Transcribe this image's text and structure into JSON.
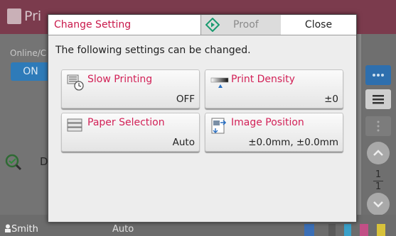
{
  "background": {
    "title_text": "Pri",
    "online_label": "Online/C",
    "on_button": "ON",
    "d_text": "D",
    "page_top": "1",
    "page_bottom": "1",
    "user": "Smith",
    "auto_text": "Auto"
  },
  "dialog": {
    "title": "Change Setting",
    "proof_label": "Proof",
    "close_label": "Close",
    "description": "The following settings can be changed.",
    "settings": [
      {
        "label": "Slow Printing",
        "value": "OFF",
        "icon": "slow-printing-icon"
      },
      {
        "label": "Print Density",
        "value": "±0",
        "icon": "print-density-icon"
      },
      {
        "label": "Paper Selection",
        "value": "Auto",
        "icon": "paper-tray-icon"
      },
      {
        "label": "Image Position",
        "value": "±0.0mm, ±0.0mm",
        "icon": "image-position-icon"
      }
    ]
  },
  "colors": {
    "accent": "#c9184a",
    "header_bg": "#7b3b4d",
    "on_button": "#2e7bb9",
    "proof_icon": "#1a9b6f"
  }
}
